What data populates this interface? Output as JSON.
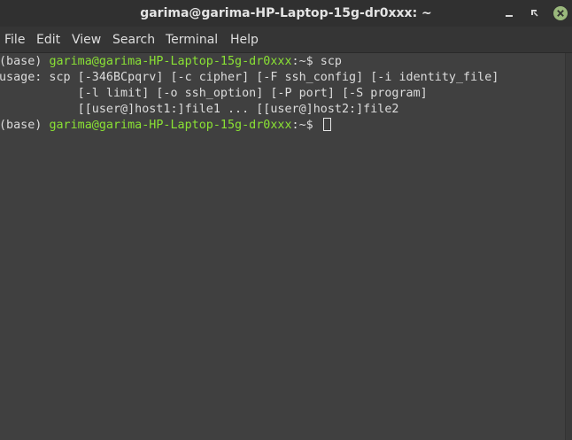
{
  "window": {
    "title": "garima@garima-HP-Laptop-15g-dr0xxx: ~"
  },
  "menu": {
    "file": "File",
    "edit": "Edit",
    "view": "View",
    "search": "Search",
    "terminal": "Terminal",
    "help": "Help"
  },
  "terminal": {
    "line1": {
      "env": "(base) ",
      "userhost": "garima@garima-HP-Laptop-15g-dr0xxx",
      "path": ":~$ ",
      "command": "scp"
    },
    "line2": "usage: scp [-346BCpqrv] [-c cipher] [-F ssh_config] [-i identity_file]",
    "line3": "           [-l limit] [-o ssh_option] [-P port] [-S program]",
    "line4": "           [[user@]host1:]file1 ... [[user@]host2:]file2",
    "line5": {
      "env": "(base) ",
      "userhost": "garima@garima-HP-Laptop-15g-dr0xxx",
      "path": ":~$ "
    }
  },
  "colors": {
    "prompt_user": "#8ae234",
    "terminal_bg": "#404040",
    "text": "#dcdcdc"
  },
  "icons": {
    "minimize": "minimize-icon",
    "maximize": "maximize-icon",
    "close": "close-icon"
  }
}
